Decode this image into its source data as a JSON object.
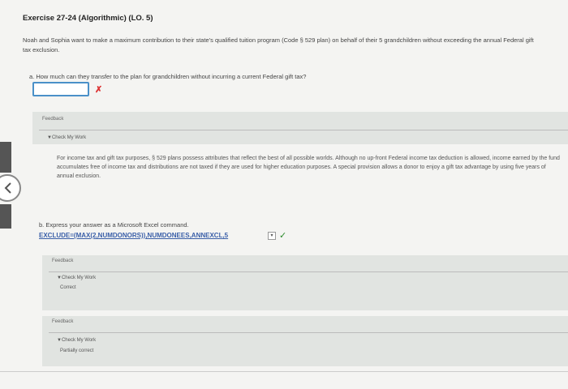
{
  "exercise": {
    "title": "Exercise 27-24 (Algorithmic) (LO. 5)",
    "intro": "Noah and Sophia want to make a maximum contribution to their state's qualified tuition program (Code § 529 plan) on behalf of their 5 grandchildren without exceeding the annual Federal gift tax exclusion."
  },
  "part_a": {
    "question": "a.  How much can they transfer to the plan for grandchildren without incurring a current Federal gift tax?",
    "answer_value": "",
    "result_mark": "✗",
    "feedback_label": "Feedback",
    "check_label": "▼Check My Work",
    "explanation": "For income tax and gift tax purposes, § 529 plans possess attributes that reflect the best of all possible worlds. Although no up-front Federal income tax deduction is allowed, income earned by the fund accumulates free of income tax and distributions are not taxed if they are used for higher education purposes. A special provision allows a donor to enjoy a gift tax advantage by using five years of annual exclusion."
  },
  "part_b": {
    "question": "b.  Express your answer as a Microsoft Excel command.",
    "formula": "EXCLUDE=(MAX(2,NUMDONORS)),NUMDONEES,ANNEXCL,5",
    "caret": "▾",
    "result_mark": "✓",
    "feedback1_label": "Feedback",
    "check1_label": "▼Check My Work",
    "status1": "Correct",
    "feedback2_label": "Feedback",
    "check2_label": "▼Check My Work",
    "status2": "Partially correct"
  },
  "colors": {
    "accent_blue": "#4a90c8",
    "error_red": "#d33333",
    "success_green": "#2a8a2a",
    "panel_gray": "#e1e4e1"
  },
  "icons": {
    "nav": "chevron-left-icon"
  }
}
